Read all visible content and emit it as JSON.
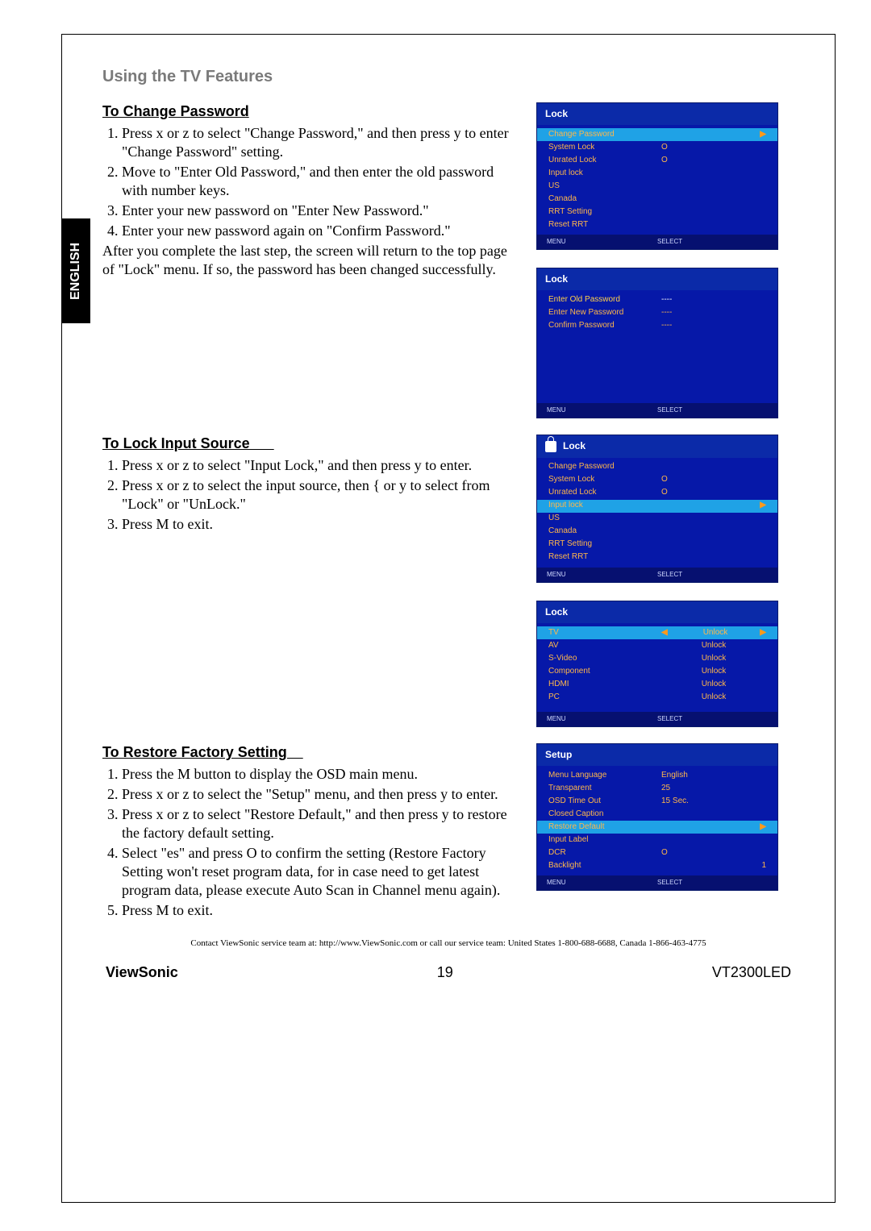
{
  "lang_tab": "ENGLISH",
  "section_header": "Using the TV Features",
  "change_pw": {
    "header": "To Change Password",
    "steps": [
      "Press  x  or  z  to select \"Change Password,\" and then press  y  to enter \"Change Password\" setting.",
      "Move to \"Enter Old Password,\" and then enter the old password with number keys.",
      "Enter your new password on \"Enter New Password.\"",
      "Enter your new password again on \"Confirm Password.\""
    ],
    "after": "After you complete the last step, the screen will return to the top page of \"Lock\" menu. If so, the password has been changed successfully."
  },
  "lock_src": {
    "header": "To Lock Input Source      ",
    "steps": [
      "Press  x  or  z  to select \"Input Lock,\" and then press      y  to enter.",
      "Press  x  or  z  to select the input source, then  {  or  y  to select from \"Lock\" or \"UnLock.\"",
      "Press  M          to exit."
    ]
  },
  "restore": {
    "header": "To Restore Factory Setting    ",
    "steps": [
      "Press the  M          button to display the OSD main menu.",
      "Press  x  or  z  to select the \"Setup\" menu, and then press  y  to enter.",
      "Press  x  or  z  to select \"Restore Default,\" and then press  y  to restore the factory default setting.",
      "Select \"es\" and press      O       to confirm the setting (Restore Factory Setting won't reset program data, for in case need to get latest program data, please execute Auto Scan in Channel menu again).",
      "Press  M          to exit."
    ]
  },
  "osd_lock1": {
    "title": "Lock",
    "rows": [
      {
        "label": "Change Password",
        "value": "",
        "sel": true,
        "arrow": true
      },
      {
        "label": "System Lock",
        "value": "O"
      },
      {
        "label": "Unrated Lock",
        "value": "O"
      },
      {
        "label": "Input lock",
        "value": ""
      },
      {
        "label": "US",
        "value": ""
      },
      {
        "label": "Canada",
        "value": ""
      },
      {
        "label": "RRT Setting",
        "value": ""
      },
      {
        "label": "Reset RRT",
        "value": ""
      }
    ],
    "foot_l": "MENU",
    "foot_r": "SELECT"
  },
  "osd_lock2": {
    "title": "Lock",
    "rows": [
      {
        "label": "Enter Old Password",
        "value": "----",
        "sel": true
      },
      {
        "label": "Enter New Password",
        "value": "----"
      },
      {
        "label": "Confirm Password",
        "value": "----"
      }
    ],
    "foot_l": "MENU",
    "foot_r": "SELECT"
  },
  "osd_lock3": {
    "title": "Lock",
    "icon": true,
    "rows": [
      {
        "label": "Change Password",
        "value": ""
      },
      {
        "label": "System Lock",
        "value": "O"
      },
      {
        "label": "Unrated Lock",
        "value": "O"
      },
      {
        "label": "Input lock",
        "value": "",
        "sel": true,
        "arrow": true
      },
      {
        "label": "US",
        "value": ""
      },
      {
        "label": "Canada",
        "value": ""
      },
      {
        "label": "RRT Setting",
        "value": ""
      },
      {
        "label": "Reset RRT",
        "value": ""
      }
    ],
    "foot_l": "MENU",
    "foot_r": "SELECT"
  },
  "osd_lock4": {
    "title": "Lock",
    "rows": [
      {
        "label": "TV",
        "value": "Unlock",
        "sel": true,
        "arrow": true,
        "arrowl": true
      },
      {
        "label": "AV",
        "value": "Unlock"
      },
      {
        "label": "S-Video",
        "value": "Unlock"
      },
      {
        "label": "Component",
        "value": "Unlock"
      },
      {
        "label": "HDMI",
        "value": "Unlock"
      },
      {
        "label": "PC",
        "value": "Unlock"
      }
    ],
    "foot_l": "MENU",
    "foot_r": "SELECT"
  },
  "osd_setup": {
    "title": "Setup",
    "rows": [
      {
        "label": "Menu Language",
        "value": "English"
      },
      {
        "label": "Transparent",
        "value": "25"
      },
      {
        "label": "OSD Time Out",
        "value": "15 Sec."
      },
      {
        "label": "Closed Caption",
        "value": ""
      },
      {
        "label": "Restore Default",
        "value": "",
        "sel": true,
        "arrow": true
      },
      {
        "label": "Input Label",
        "value": ""
      },
      {
        "label": "DCR",
        "value": "O"
      },
      {
        "label": "Backlight",
        "value": "1"
      }
    ],
    "foot_l": "MENU",
    "foot_r": "SELECT"
  },
  "contact": "Contact ViewSonic service team at: http://www.ViewSonic.com or call our service team: United States 1-800-688-6688, Canada 1-866-463-4775",
  "footer": {
    "brand": "ViewSonic",
    "page": "19",
    "model": "VT2300LED"
  }
}
